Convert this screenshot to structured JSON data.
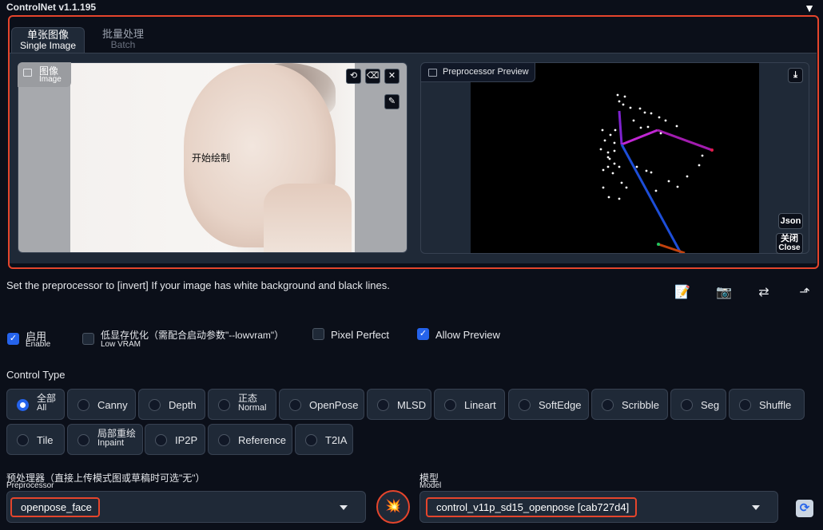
{
  "app": {
    "title": "ControlNet v1.1.195",
    "collapse_icon": "▼"
  },
  "tabs": [
    {
      "label": "单张图像",
      "sub": "Single Image"
    },
    {
      "label": "批量处理",
      "sub": "Batch"
    }
  ],
  "image_panel": {
    "label": "图像",
    "label_sub": "Image",
    "placeholder": "开始绘制",
    "tools": {
      "undo": "⟲",
      "erase": "⌫",
      "close": "✕",
      "brush": "✎"
    }
  },
  "preview_panel": {
    "label": "Preprocessor Preview",
    "download_icon": "⤓",
    "json_button": "Json",
    "close_button": "关闭",
    "close_button_sub": "Close"
  },
  "hint_text": "Set the preprocessor to [invert] If your image has white background and black lines.",
  "toolbar_icons": {
    "edit": "📝",
    "camera": "📷",
    "swap": "⇄",
    "upload": "⬏"
  },
  "options": {
    "enable": {
      "label": "启用",
      "sub": "Enable",
      "checked": true
    },
    "lowvram": {
      "label": "低显存优化（需配合启动参数\"--lowvram\"）",
      "sub": "Low VRAM",
      "checked": false
    },
    "pixel_perfect": {
      "label": "Pixel Perfect",
      "checked": false
    },
    "allow_preview": {
      "label": "Allow Preview",
      "checked": true
    }
  },
  "control_type": {
    "label": "Control Type",
    "selected": "全部",
    "items_row1": [
      {
        "label": "全部",
        "sub": "All"
      },
      {
        "label": "Canny"
      },
      {
        "label": "Depth"
      },
      {
        "label": "正态",
        "sub": "Normal"
      },
      {
        "label": "OpenPose"
      },
      {
        "label": "MLSD"
      },
      {
        "label": "Lineart"
      },
      {
        "label": "SoftEdge"
      },
      {
        "label": "Scribble"
      },
      {
        "label": "Seg"
      },
      {
        "label": "Shuffle"
      }
    ],
    "items_row2": [
      {
        "label": "Tile"
      },
      {
        "label": "局部重绘",
        "sub": "Inpaint"
      },
      {
        "label": "IP2P"
      },
      {
        "label": "Reference"
      },
      {
        "label": "T2IA"
      }
    ]
  },
  "preprocessor": {
    "title": "预处理器（直接上传模式图或草稿时可选\"无\"）",
    "sub": "Preprocessor",
    "value": "openpose_face"
  },
  "model": {
    "title": "模型",
    "sub": "Model",
    "value": "control_v11p_sd15_openpose [cab727d4]"
  },
  "run_icon": "💥",
  "refresh_icon": "⟳",
  "colors": {
    "background": "#0b0f19",
    "panel": "#1f2937",
    "accent_blue": "#2563eb",
    "highlight_red": "#e5452c"
  }
}
